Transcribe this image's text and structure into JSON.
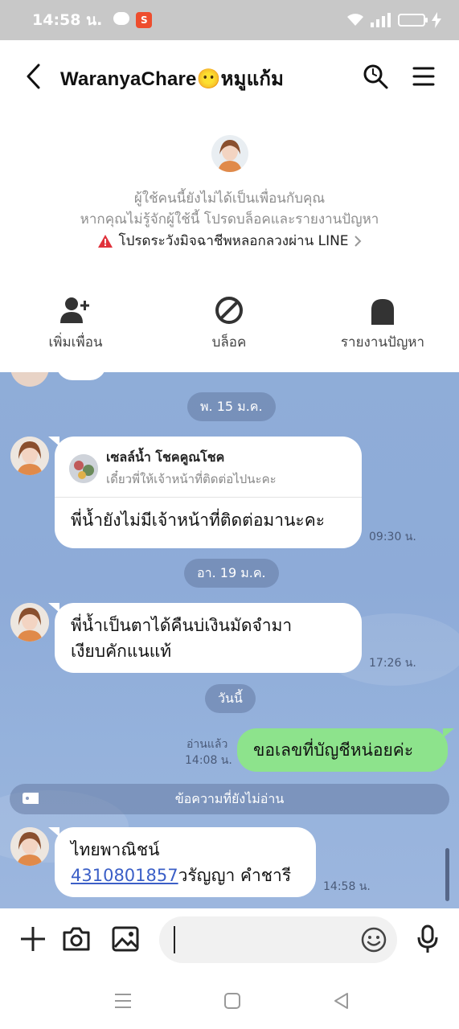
{
  "status_bar": {
    "time": "14:58 น."
  },
  "header": {
    "title": "WaranyaChare😶หมูแก้ม"
  },
  "notice": {
    "line1": "ผู้ใช้คนนี้ยังไม่ได้เป็นเพื่อนกับคุณ",
    "line2": "หากคุณไม่รู้จักผู้ใช้นี้ โปรดบล็อคและรายงานปัญหา",
    "warning": "โปรดระวังมิจฉาชีพหลอกลวงผ่าน LINE",
    "warning_color": "#e0323c"
  },
  "actions": [
    {
      "label": "เพิ่มเพื่อน",
      "icon": "add-friend-icon"
    },
    {
      "label": "บล็อค",
      "icon": "block-icon"
    },
    {
      "label": "รายงานปัญหา",
      "icon": "report-icon"
    }
  ],
  "chat": {
    "background": "#8fadd8",
    "dates": [
      "พ. 15 ม.ค.",
      "อา. 19 ม.ค.",
      "วันนี้"
    ],
    "reply": {
      "quoted_name": "เซลล์น้ำ โชคคูณโชค",
      "quoted_text": "เดี๋ยวพี่ให้เจ้าหน้าที่ติดต่อไปนะคะ",
      "text": "พี่น้ำยังไม่มีเจ้าหน้าที่ติดต่อมานะคะ",
      "time": "09:30 น."
    },
    "msg2": {
      "line1": "พี่น้ำเป็นตาได้คืนบ่เงินมัดจำมา",
      "line2": "เงียบคักแนแท้",
      "time": "17:26 น."
    },
    "mine": {
      "text": "ขอเลขที่บัญชีหน่อยค่ะ",
      "read": "อ่านแล้ว",
      "time": "14:08 น.",
      "color": "#8de38c"
    },
    "unread_label": "ข้อความที่ยังไม่อ่าน",
    "msg3": {
      "line1": "ไทยพาณิชน์",
      "account": "4310801857",
      "name": "วรัญญา คำชารี",
      "time": "14:58 น."
    }
  },
  "input": {
    "value": ""
  }
}
